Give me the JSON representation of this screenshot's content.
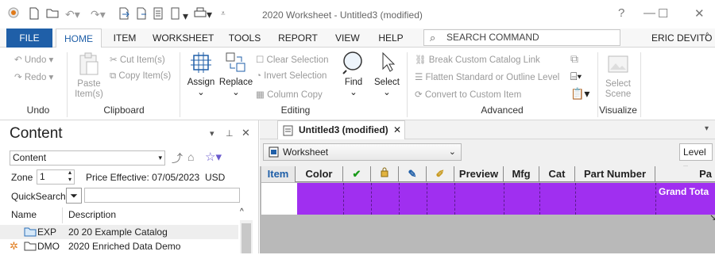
{
  "app": {
    "title": "2020 Worksheet - Untitled3 (modified)",
    "quick_access": [
      "app-logo-icon",
      "new-icon",
      "open-icon",
      "undo-icon",
      "redo-icon",
      "export-icon",
      "import-icon",
      "report-icon",
      "doc-icon",
      "print-icon",
      "customize-icon"
    ]
  },
  "tabs": {
    "file": "FILE",
    "home": "HOME",
    "item": "ITEM",
    "worksheet": "WORKSHEET",
    "tools": "TOOLS",
    "report": "REPORT",
    "view": "VIEW",
    "help": "HELP"
  },
  "search": {
    "placeholder": "SEARCH COMMAND"
  },
  "user": {
    "name": "ERIC DEVITO"
  },
  "ribbon": {
    "undo": {
      "undo": "Undo",
      "redo": "Redo",
      "group": "Undo"
    },
    "clipboard": {
      "paste": "Paste",
      "paste2": "Item(s)",
      "cut": "Cut Item(s)",
      "copy": "Copy Item(s)",
      "group": "Clipboard"
    },
    "editing": {
      "assign": "Assign",
      "replace": "Replace",
      "clear": "Clear Selection",
      "invert": "Invert Selection",
      "column_copy": "Column Copy",
      "find": "Find",
      "select": "Select",
      "group": "Editing"
    },
    "advanced": {
      "break": "Break Custom Catalog Link",
      "flatten": "Flatten Standard or Outline Level",
      "convert": "Convert to Custom Item",
      "group": "Advanced"
    },
    "visualize": {
      "select": "Select",
      "scene": "Scene",
      "group": "Visualize"
    }
  },
  "panel": {
    "title": "Content",
    "content_select": "Content",
    "zone_label": "Zone",
    "zone_value": "1",
    "price_effective": "Price Effective: 07/05/2023",
    "currency": "USD",
    "quicksearch_label": "QuickSearch",
    "quicksearch_value": "",
    "col_name": "Name",
    "col_desc": "Description",
    "rows": [
      {
        "name": "EXP",
        "desc": "20 20 Example Catalog"
      },
      {
        "name": "DMO",
        "desc": "2020 Enriched Data Demo"
      }
    ]
  },
  "doc": {
    "tab": "Untitled3 (modified)",
    "worksheet_select": "Worksheet",
    "level": "Level"
  },
  "grid": {
    "headers": [
      "Item",
      "Color",
      "",
      "",
      "",
      "",
      "Preview",
      "Mfg",
      "Cat",
      "Part Number",
      "Pa"
    ],
    "grand_total": "Grand Tota"
  },
  "colors": {
    "accent": "#1f5fa8",
    "total_row": "#a02ff0"
  }
}
